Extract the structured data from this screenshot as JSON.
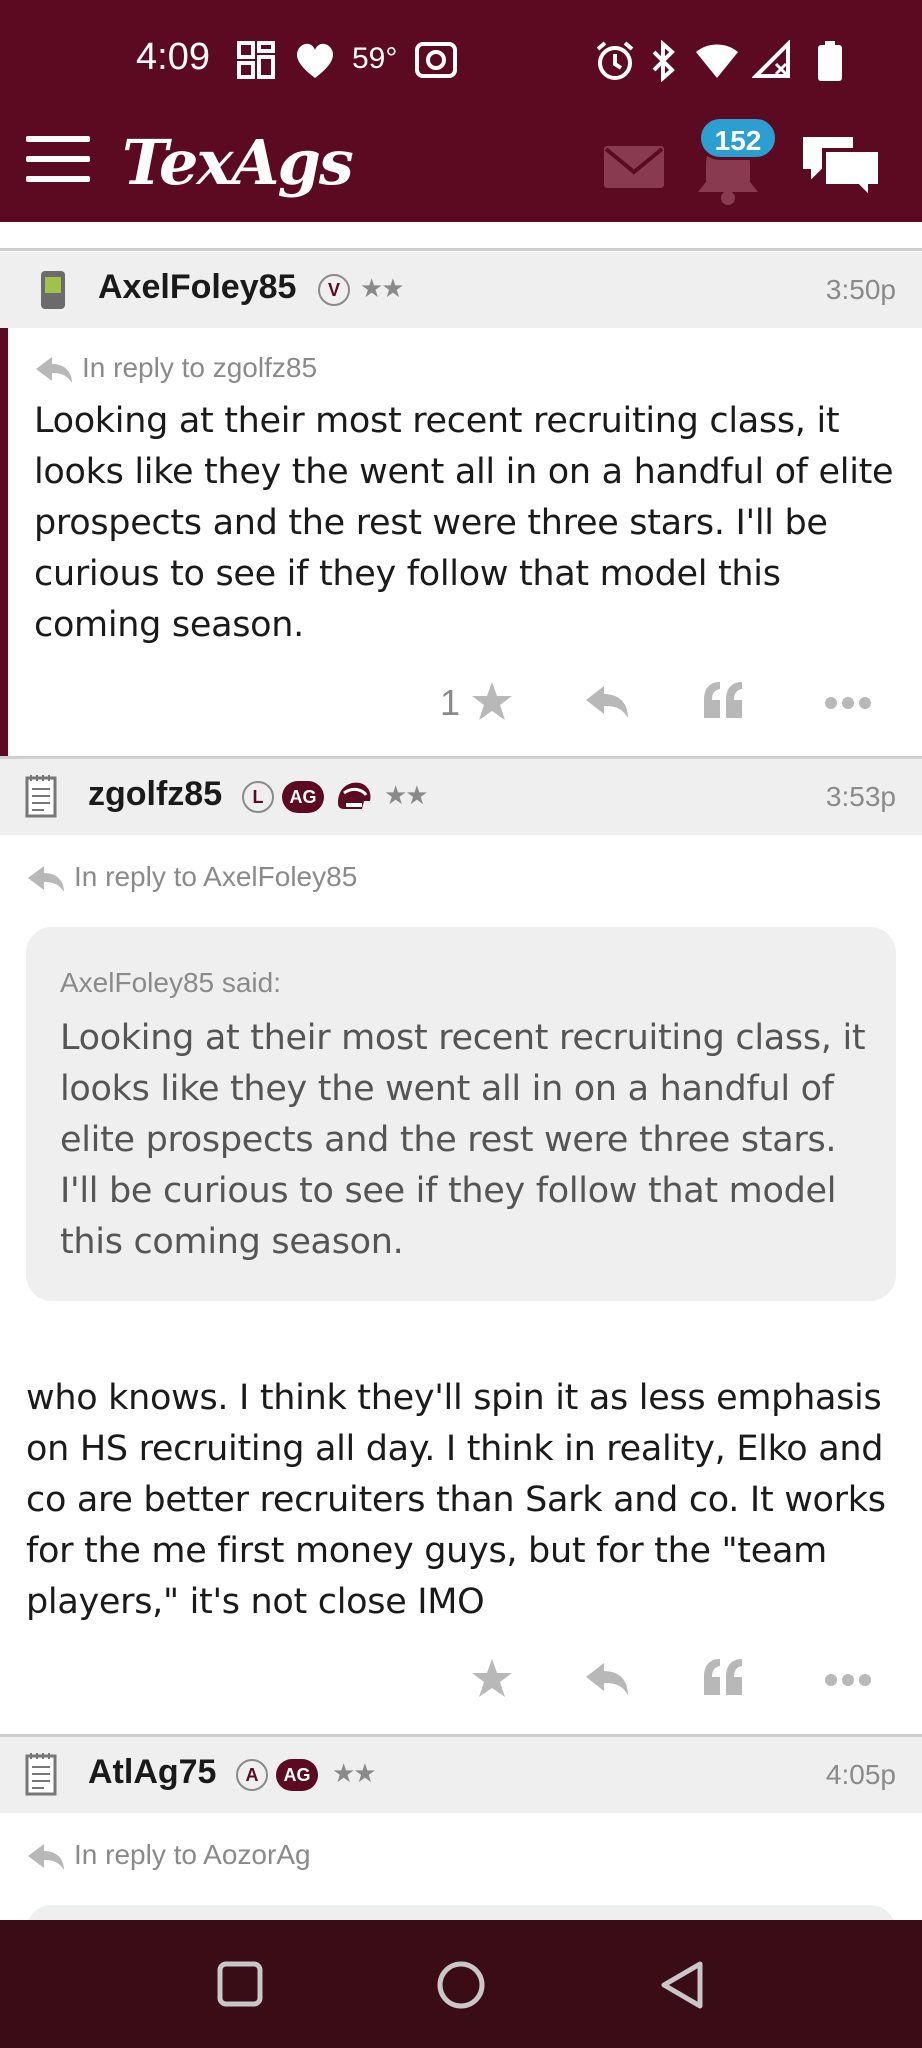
{
  "status_bar": {
    "time": "4:09",
    "temperature": "59°"
  },
  "header": {
    "logo": "TexAgs",
    "notification_count": "152"
  },
  "posts": [
    {
      "username": "AxelFoley85",
      "badges": [
        "V"
      ],
      "time": "3:50p",
      "reply_to": "In reply to zgolfz85",
      "body": "Looking at their most recent recruiting class, it looks like they the went all in on a handful of elite prospects and the rest were three stars. I'll be curious to see if they follow that model this coming season.",
      "like_count": "1"
    },
    {
      "username": "zgolfz85",
      "badges": [
        "L",
        "AG"
      ],
      "time": "3:53p",
      "reply_to": "In reply to AxelFoley85",
      "quote_by": "AxelFoley85 said:",
      "quote_text": "Looking at their most recent recruiting class, it looks like they the went all in on a handful of elite prospects and the rest were three stars. I'll be curious to see if they follow that model this coming season.",
      "body": "who knows. I think they'll spin it as less emphasis on HS recruiting all day. I think in reality, Elko and co are better recruiters than Sark and co. It works for the me first money guys, but for the \"team players,\" it's not close IMO"
    },
    {
      "username": "AtlAg75",
      "badges": [
        "A",
        "AG"
      ],
      "time": "4:05p",
      "reply_to": "In reply to AozorAg"
    }
  ],
  "icons": {
    "menu": "hamburger-icon",
    "mail": "mail-icon",
    "bell": "bell-icon",
    "chat": "chat-icon",
    "star": "star-icon",
    "reply": "reply-icon",
    "quote": "quote-icon",
    "more": "more-icon"
  },
  "colors": {
    "brand": "#5c0a22",
    "badge_blue": "#2b9fcf",
    "muted": "#8a8a8a",
    "icon_gray": "#b8b8b8"
  }
}
